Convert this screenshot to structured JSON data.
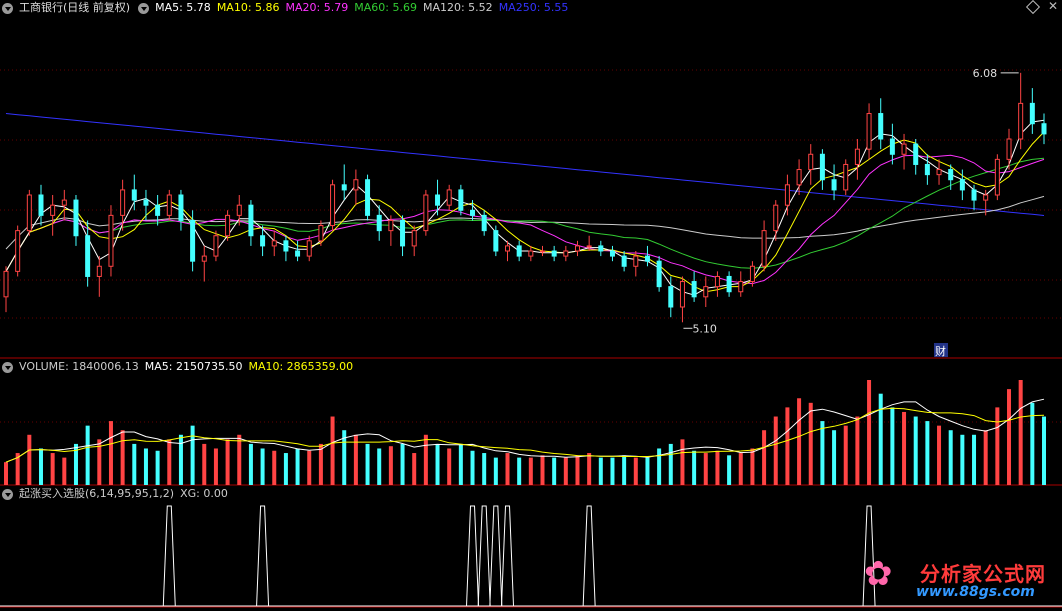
{
  "price_panel": {
    "title": "工商银行(日线 前复权)",
    "ma_labels": [
      {
        "text": "MA5: 5.78",
        "color": "#ffffff"
      },
      {
        "text": "MA10: 5.86",
        "color": "#ffff00"
      },
      {
        "text": "MA20: 5.79",
        "color": "#ff33ff"
      },
      {
        "text": "MA60: 5.69",
        "color": "#33cc33"
      },
      {
        "text": "MA120: 5.52",
        "color": "#cccccc"
      },
      {
        "text": "MA250: 5.55",
        "color": "#3333ff"
      }
    ],
    "high_label": "6.08",
    "low_label": "5.10",
    "event_marker": "财"
  },
  "volume_panel": {
    "labels": [
      {
        "text": "VOLUME: 1840006.13",
        "color": "#cccccc"
      },
      {
        "text": "MA5: 2150735.50",
        "color": "#ffffff"
      },
      {
        "text": "MA10: 2865359.00",
        "color": "#ffff00"
      }
    ]
  },
  "indicator_panel": {
    "labels": [
      {
        "text": "起涨买入选股(6,14,95,95,1,2)",
        "color": "#cccccc"
      },
      {
        "text": "XG: 0.00",
        "color": "#cccccc"
      }
    ]
  },
  "watermark": {
    "title": "分析家公式网",
    "url": "www.88gs.com"
  },
  "icons": {
    "collapse": "collapse-triangle-icon",
    "settings": "diamond-icon",
    "close": "close-icon",
    "logo": "flower-logo-icon"
  },
  "chart_data": {
    "type": "candlestick",
    "y_range": [
      5.05,
      6.15
    ],
    "candles": [
      [
        5.2,
        5.32,
        5.14,
        5.3
      ],
      [
        5.3,
        5.48,
        5.28,
        5.46
      ],
      [
        5.46,
        5.62,
        5.44,
        5.6
      ],
      [
        5.6,
        5.64,
        5.48,
        5.52
      ],
      [
        5.52,
        5.6,
        5.44,
        5.56
      ],
      [
        5.56,
        5.62,
        5.5,
        5.58
      ],
      [
        5.58,
        5.6,
        5.4,
        5.44
      ],
      [
        5.44,
        5.5,
        5.24,
        5.28
      ],
      [
        5.28,
        5.36,
        5.2,
        5.32
      ],
      [
        5.32,
        5.56,
        5.28,
        5.52
      ],
      [
        5.52,
        5.66,
        5.46,
        5.62
      ],
      [
        5.62,
        5.68,
        5.54,
        5.58
      ],
      [
        5.58,
        5.62,
        5.5,
        5.56
      ],
      [
        5.56,
        5.6,
        5.48,
        5.52
      ],
      [
        5.52,
        5.62,
        5.5,
        5.6
      ],
      [
        5.6,
        5.62,
        5.46,
        5.5
      ],
      [
        5.5,
        5.54,
        5.3,
        5.34
      ],
      [
        5.34,
        5.4,
        5.26,
        5.36
      ],
      [
        5.36,
        5.46,
        5.34,
        5.44
      ],
      [
        5.44,
        5.54,
        5.42,
        5.52
      ],
      [
        5.52,
        5.6,
        5.48,
        5.56
      ],
      [
        5.56,
        5.58,
        5.4,
        5.44
      ],
      [
        5.44,
        5.48,
        5.36,
        5.4
      ],
      [
        5.4,
        5.46,
        5.36,
        5.42
      ],
      [
        5.42,
        5.44,
        5.34,
        5.38
      ],
      [
        5.38,
        5.42,
        5.34,
        5.36
      ],
      [
        5.36,
        5.44,
        5.34,
        5.42
      ],
      [
        5.42,
        5.5,
        5.4,
        5.48
      ],
      [
        5.48,
        5.66,
        5.46,
        5.64
      ],
      [
        5.64,
        5.72,
        5.58,
        5.62
      ],
      [
        5.62,
        5.7,
        5.56,
        5.66
      ],
      [
        5.66,
        5.68,
        5.5,
        5.52
      ],
      [
        5.52,
        5.56,
        5.42,
        5.46
      ],
      [
        5.46,
        5.52,
        5.4,
        5.5
      ],
      [
        5.5,
        5.52,
        5.36,
        5.4
      ],
      [
        5.4,
        5.48,
        5.36,
        5.46
      ],
      [
        5.46,
        5.62,
        5.44,
        5.6
      ],
      [
        5.6,
        5.66,
        5.52,
        5.56
      ],
      [
        5.56,
        5.64,
        5.54,
        5.62
      ],
      [
        5.62,
        5.64,
        5.52,
        5.54
      ],
      [
        5.54,
        5.58,
        5.5,
        5.52
      ],
      [
        5.52,
        5.54,
        5.44,
        5.46
      ],
      [
        5.46,
        5.48,
        5.36,
        5.38
      ],
      [
        5.38,
        5.42,
        5.34,
        5.4
      ],
      [
        5.4,
        5.42,
        5.34,
        5.36
      ],
      [
        5.36,
        5.4,
        5.34,
        5.38
      ],
      [
        5.38,
        5.4,
        5.36,
        5.38
      ],
      [
        5.38,
        5.4,
        5.34,
        5.36
      ],
      [
        5.36,
        5.4,
        5.34,
        5.38
      ],
      [
        5.38,
        5.42,
        5.36,
        5.4
      ],
      [
        5.4,
        5.44,
        5.38,
        5.4
      ],
      [
        5.4,
        5.42,
        5.36,
        5.38
      ],
      [
        5.38,
        5.4,
        5.34,
        5.36
      ],
      [
        5.36,
        5.38,
        5.3,
        5.32
      ],
      [
        5.32,
        5.38,
        5.28,
        5.36
      ],
      [
        5.36,
        5.4,
        5.32,
        5.34
      ],
      [
        5.34,
        5.36,
        5.22,
        5.24
      ],
      [
        5.24,
        5.28,
        5.12,
        5.16
      ],
      [
        5.16,
        5.28,
        5.1,
        5.26
      ],
      [
        5.26,
        5.3,
        5.18,
        5.2
      ],
      [
        5.2,
        5.28,
        5.16,
        5.24
      ],
      [
        5.24,
        5.3,
        5.2,
        5.28
      ],
      [
        5.28,
        5.3,
        5.2,
        5.22
      ],
      [
        5.22,
        5.3,
        5.2,
        5.26
      ],
      [
        5.26,
        5.34,
        5.24,
        5.32
      ],
      [
        5.32,
        5.5,
        5.3,
        5.46
      ],
      [
        5.46,
        5.58,
        5.42,
        5.56
      ],
      [
        5.56,
        5.68,
        5.52,
        5.64
      ],
      [
        5.64,
        5.74,
        5.6,
        5.7
      ],
      [
        5.7,
        5.8,
        5.64,
        5.76
      ],
      [
        5.76,
        5.78,
        5.62,
        5.66
      ],
      [
        5.66,
        5.72,
        5.58,
        5.62
      ],
      [
        5.62,
        5.74,
        5.6,
        5.72
      ],
      [
        5.72,
        5.82,
        5.66,
        5.78
      ],
      [
        5.78,
        5.96,
        5.74,
        5.92
      ],
      [
        5.92,
        5.98,
        5.78,
        5.82
      ],
      [
        5.82,
        5.88,
        5.72,
        5.76
      ],
      [
        5.76,
        5.84,
        5.7,
        5.8
      ],
      [
        5.8,
        5.82,
        5.68,
        5.72
      ],
      [
        5.72,
        5.76,
        5.64,
        5.68
      ],
      [
        5.68,
        5.74,
        5.64,
        5.7
      ],
      [
        5.7,
        5.72,
        5.62,
        5.66
      ],
      [
        5.66,
        5.7,
        5.58,
        5.62
      ],
      [
        5.62,
        5.64,
        5.54,
        5.58
      ],
      [
        5.58,
        5.62,
        5.52,
        5.6
      ],
      [
        5.6,
        5.76,
        5.58,
        5.74
      ],
      [
        5.74,
        5.86,
        5.7,
        5.82
      ],
      [
        5.82,
        6.08,
        5.78,
        5.96
      ],
      [
        5.96,
        6.02,
        5.84,
        5.88
      ],
      [
        5.88,
        5.92,
        5.8,
        5.84
      ]
    ],
    "volume": [
      10,
      14,
      22,
      16,
      14,
      12,
      18,
      26,
      20,
      28,
      24,
      18,
      16,
      15,
      20,
      22,
      26,
      18,
      16,
      20,
      22,
      18,
      16,
      15,
      14,
      16,
      15,
      18,
      30,
      24,
      22,
      18,
      16,
      17,
      18,
      14,
      22,
      18,
      16,
      18,
      15,
      14,
      12,
      14,
      12,
      12,
      13,
      12,
      12,
      13,
      14,
      12,
      12,
      13,
      12,
      12,
      16,
      18,
      20,
      15,
      14,
      15,
      13,
      14,
      16,
      24,
      30,
      34,
      38,
      36,
      28,
      24,
      26,
      30,
      46,
      40,
      34,
      32,
      30,
      28,
      26,
      24,
      22,
      22,
      24,
      34,
      42,
      46,
      36,
      30
    ],
    "xg_signal_indices": [
      14,
      22,
      40,
      41,
      42,
      43,
      50,
      74
    ],
    "high_value": 6.08,
    "low_value": 5.1
  }
}
